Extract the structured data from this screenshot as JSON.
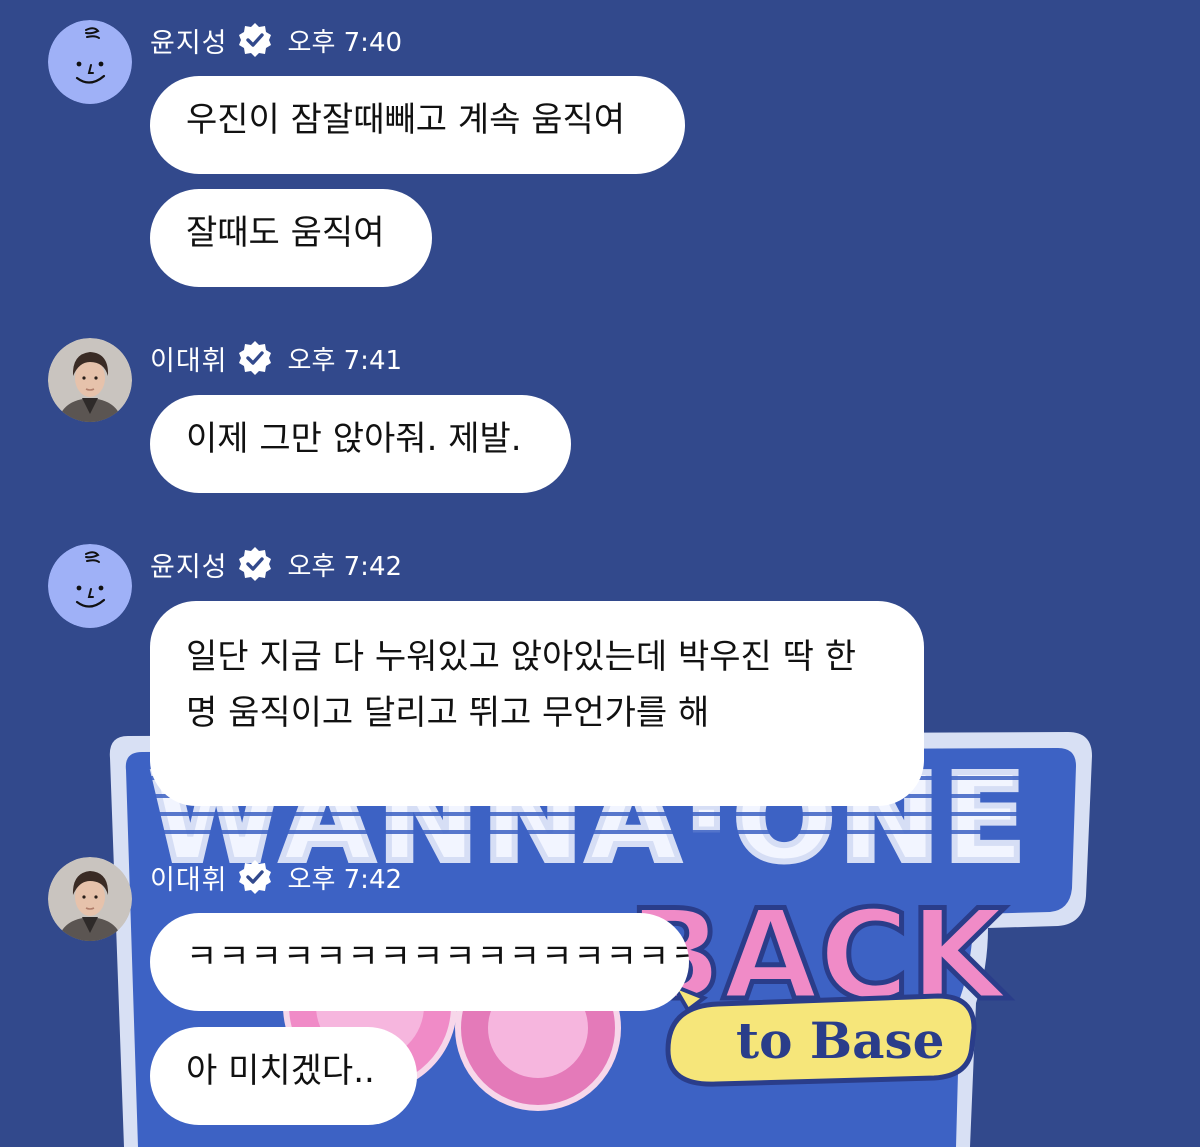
{
  "colors": {
    "background": "#32498c",
    "bubble": "#ffffff",
    "text": "#111111",
    "meta_text": "#ffffff",
    "verified_badge": "#ffffff",
    "avatar_yoon": "#9fb1f7"
  },
  "icons": {
    "verified": "verified-badge-icon"
  },
  "background_art": {
    "line1": "WANNA·ONE",
    "line2": "BACK",
    "line3": "to Base"
  },
  "messages": [
    {
      "sender": "윤지성",
      "time": "오후 7:40",
      "avatar": "drawn-face",
      "bubbles": [
        "우진이 잠잘때빼고 계속 움직여",
        "잘때도 움직여"
      ]
    },
    {
      "sender": "이대휘",
      "time": "오후 7:41",
      "avatar": "photo",
      "bubbles": [
        "이제 그만 앉아줘. 제발."
      ]
    },
    {
      "sender": "윤지성",
      "time": "오후 7:42",
      "avatar": "drawn-face",
      "bubbles": [
        "일단 지금 다 누워있고 앉아있는데 박우진 딱 한 명 움직이고 달리고 뛰고 무언가를 해"
      ]
    },
    {
      "sender": "이대휘",
      "time": "오후 7:42",
      "avatar": "photo",
      "bubbles": [
        "ㅋㅋㅋㅋㅋㅋㅋㅋㅋㅋㅋㅋㅋㅋㅋㅋ",
        "아 미치겠다.."
      ]
    }
  ]
}
